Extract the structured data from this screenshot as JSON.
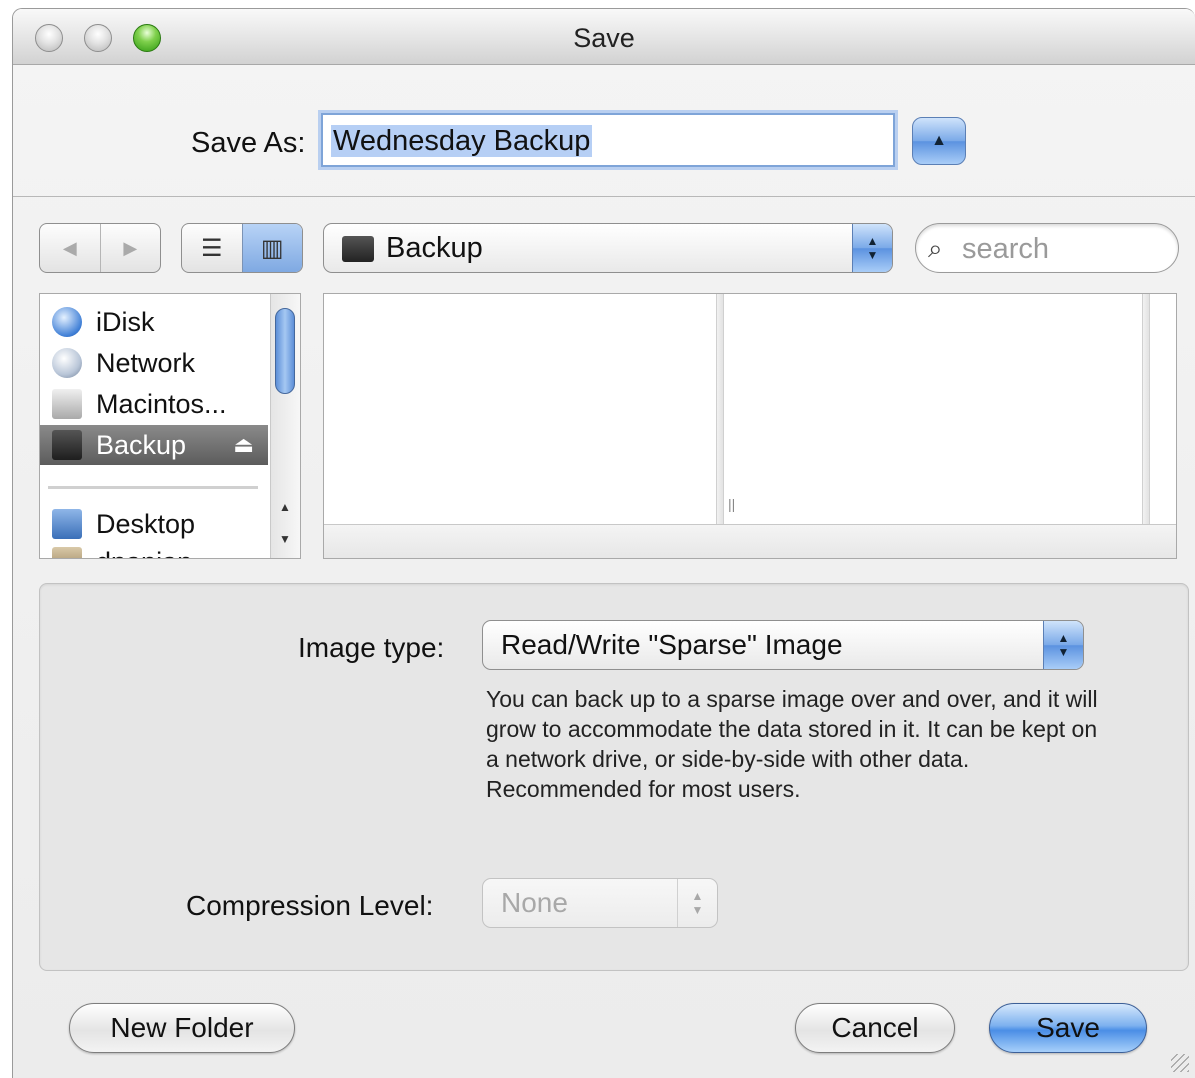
{
  "window": {
    "title": "Save"
  },
  "save_as": {
    "label": "Save As:",
    "value": "Wednesday Backup"
  },
  "toolbar": {
    "back_icon": "back-arrow-icon",
    "forward_icon": "forward-arrow-icon",
    "list_view_icon": "list-view-icon",
    "column_view_icon": "column-view-icon",
    "location": "Backup",
    "search_placeholder": "search"
  },
  "sidebar": {
    "items": [
      {
        "label": "iDisk",
        "icon": "idisk-icon"
      },
      {
        "label": "Network",
        "icon": "network-icon"
      },
      {
        "label": "Macintos...",
        "icon": "hard-drive-icon"
      },
      {
        "label": "Backup",
        "icon": "external-drive-icon",
        "selected": true
      },
      {
        "label": "Desktop",
        "icon": "desktop-icon"
      },
      {
        "label": "dpanian",
        "icon": "home-icon"
      }
    ]
  },
  "options": {
    "image_type_label": "Image type:",
    "image_type_value": "Read/Write \"Sparse\" Image",
    "description": "You can back up to a sparse image over and over, and it will grow to accommodate the data stored in it. It can be kept on a network drive, or side-by-side with other data. Recommended for most users.",
    "compression_label": "Compression Level:",
    "compression_value": "None"
  },
  "buttons": {
    "new_folder": "New Folder",
    "cancel": "Cancel",
    "save": "Save"
  },
  "colors": {
    "accent": "#5b92e0",
    "selection": "#b6cff5",
    "window_bg": "#ececec"
  }
}
